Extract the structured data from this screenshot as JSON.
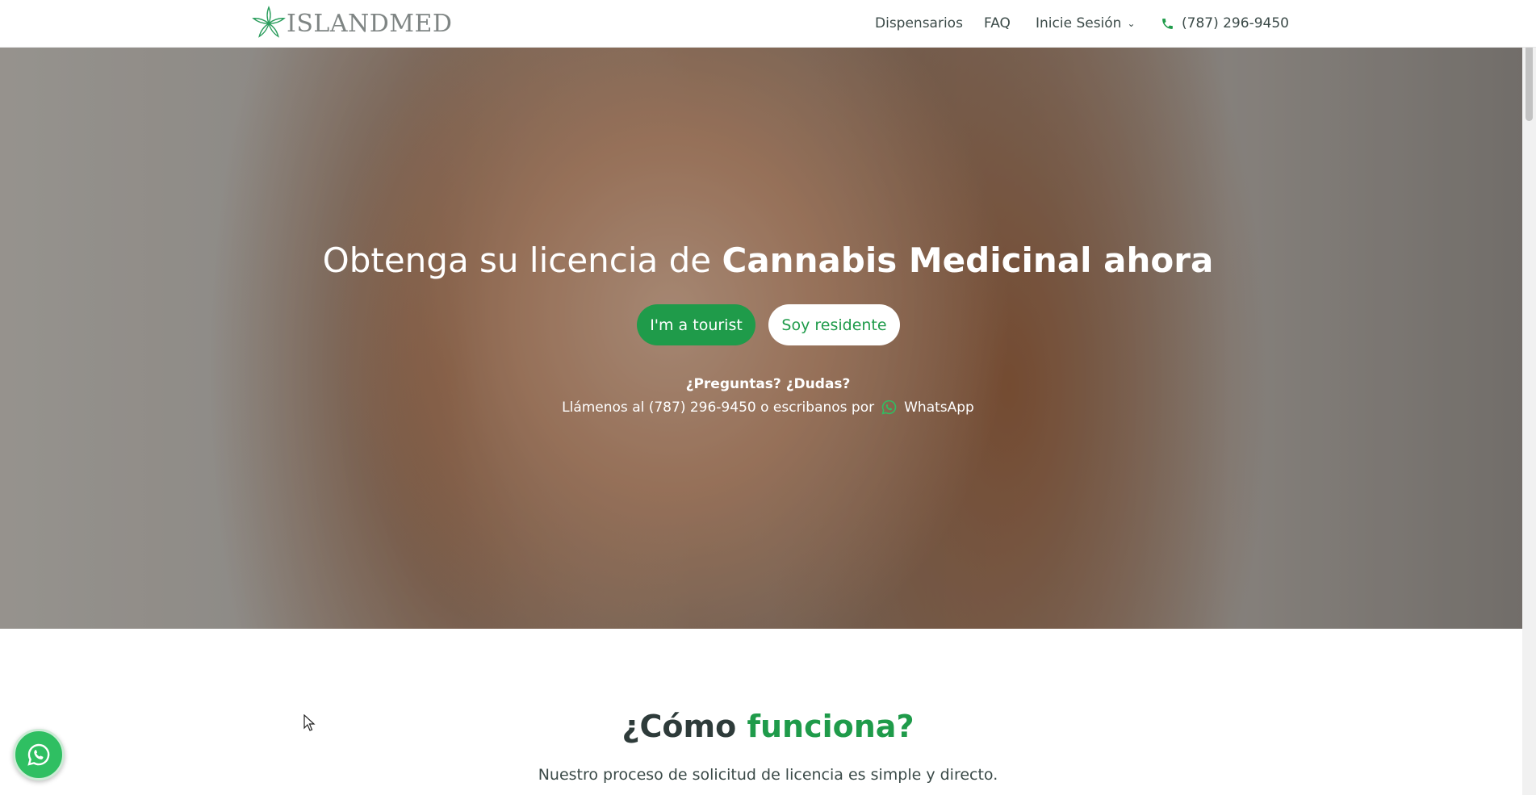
{
  "header": {
    "logo_text": "ISLANDMED",
    "nav": {
      "dispensaries": "Dispensarios",
      "faq": "FAQ",
      "login": "Inicie Sesión",
      "phone": "(787) 296-9450"
    },
    "icons": {
      "logo": "leaf-star-logo",
      "login_chevron": "chevron-down-icon",
      "phone": "phone-icon"
    }
  },
  "hero": {
    "title_normal": "Obtenga su licencia de ",
    "title_bold": "Cannabis Medicinal ahora",
    "buttons": {
      "tourist": "I'm a tourist",
      "resident": "Soy residente"
    },
    "questions": "¿Preguntas? ¿Dudas?",
    "contact_text": "Llámenos al (787) 296-9450 o escribanos por",
    "whatsapp_label": "WhatsApp"
  },
  "section": {
    "title_part1": "¿Cómo ",
    "title_part2": "funciona?",
    "subtitle": "Nuestro proceso de solicitud de licencia es simple y directo."
  },
  "colors": {
    "brand_green": "#1f9b4a",
    "whatsapp_green": "#2fbf62",
    "text_dark": "#2e3b3a"
  }
}
